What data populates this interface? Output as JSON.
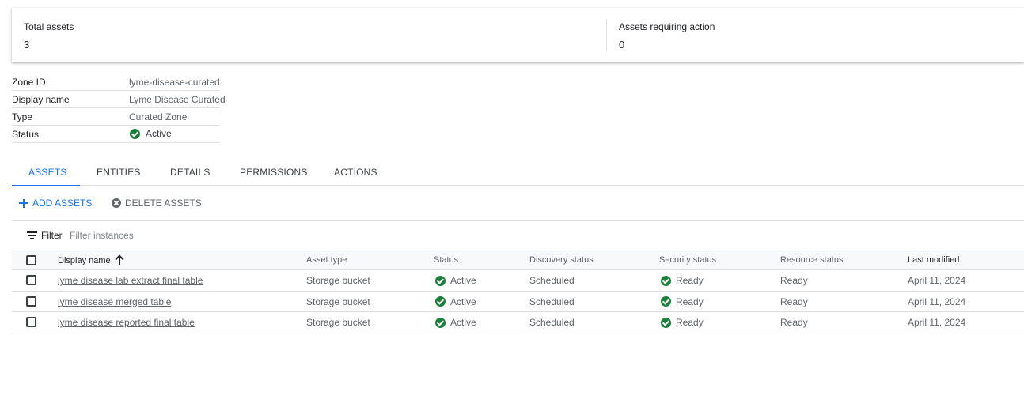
{
  "summary": {
    "total_assets_label": "Total assets",
    "total_assets_value": "3",
    "assets_requiring_action_label": "Assets requiring action",
    "assets_requiring_action_value": "0"
  },
  "zone_info": {
    "rows": [
      {
        "key": "Zone ID",
        "value": "lyme-disease-curated"
      },
      {
        "key": "Display name",
        "value": "Lyme Disease Curated"
      },
      {
        "key": "Type",
        "value": "Curated Zone"
      },
      {
        "key": "Status",
        "value": "Active",
        "icon": "check-circle-icon"
      }
    ]
  },
  "tabs": [
    {
      "label": "ASSETS",
      "active": true
    },
    {
      "label": "ENTITIES",
      "active": false
    },
    {
      "label": "DETAILS",
      "active": false
    },
    {
      "label": "PERMISSIONS",
      "active": false
    },
    {
      "label": "ACTIONS",
      "active": false
    }
  ],
  "actions": {
    "add_label": "ADD ASSETS",
    "delete_label": "DELETE ASSETS"
  },
  "filter": {
    "label": "Filter",
    "placeholder": "Filter instances"
  },
  "table": {
    "columns": [
      "Display name",
      "Asset type",
      "Status",
      "Discovery status",
      "Security status",
      "Resource status",
      "Last modified"
    ],
    "sort_column": "Display name",
    "sort_direction": "ascending",
    "rows": [
      {
        "display_name": "lyme disease lab extract final table",
        "asset_type": "Storage bucket",
        "status": "Active",
        "discovery_status": "Scheduled",
        "security_status": "Ready",
        "resource_status": "Ready",
        "last_modified": "April 11, 2024"
      },
      {
        "display_name": "lyme disease merged table",
        "asset_type": "Storage bucket",
        "status": "Active",
        "discovery_status": "Scheduled",
        "security_status": "Ready",
        "resource_status": "Ready",
        "last_modified": "April 11, 2024"
      },
      {
        "display_name": "lyme disease reported final table",
        "asset_type": "Storage bucket",
        "status": "Active",
        "discovery_status": "Scheduled",
        "security_status": "Ready",
        "resource_status": "Ready",
        "last_modified": "April 11, 2024"
      }
    ]
  },
  "colors": {
    "accent": "#1a73e8",
    "success": "#188038",
    "divider": "#dadce0"
  }
}
